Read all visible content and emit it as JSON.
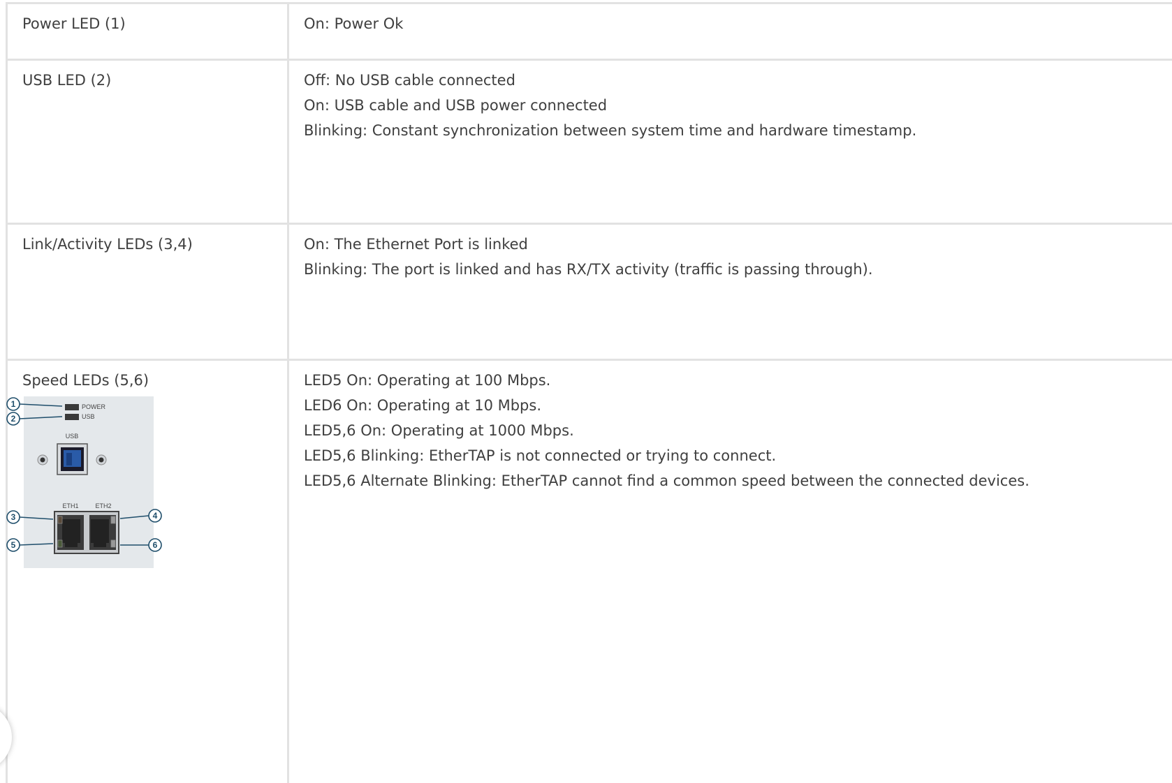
{
  "rows": [
    {
      "label": "Power LED (1)",
      "lines": [
        "On: Power Ok"
      ]
    },
    {
      "label": "USB LED (2)",
      "lines": [
        "Off: No USB cable connected",
        "On: USB cable and USB power connected",
        "Blinking: Constant synchronization between system time and hardware timestamp."
      ]
    },
    {
      "label": "Link/Activity LEDs (3,4)",
      "lines": [
        "On: The Ethernet Port is linked",
        "Blinking: The port is linked and has RX/TX activity (traffic is passing through)."
      ]
    },
    {
      "label": "Speed LEDs (5,6)",
      "lines": [
        "LED5 On: Operating at 100 Mbps.",
        "LED6 On: Operating at 10 Mbps.",
        "LED5,6 On: Operating at 1000 Mbps.",
        "LED5,6 Blinking: EtherTAP is not connected or trying to connect.",
        "LED5,6 Alternate Blinking: EtherTAP cannot find a common speed between the connected devices."
      ]
    }
  ],
  "diagram": {
    "power_label": "POWER",
    "usb_led_label": "USB",
    "usb_port_label": "USB",
    "eth1_label": "ETH1",
    "eth2_label": "ETH2",
    "callouts": [
      "1",
      "2",
      "3",
      "4",
      "5",
      "6"
    ],
    "colors": {
      "panel": "#e4e8eb",
      "callout": "#1f4e6b",
      "usb_port": "#2a5ba8",
      "led": "#3a3a3a"
    }
  }
}
